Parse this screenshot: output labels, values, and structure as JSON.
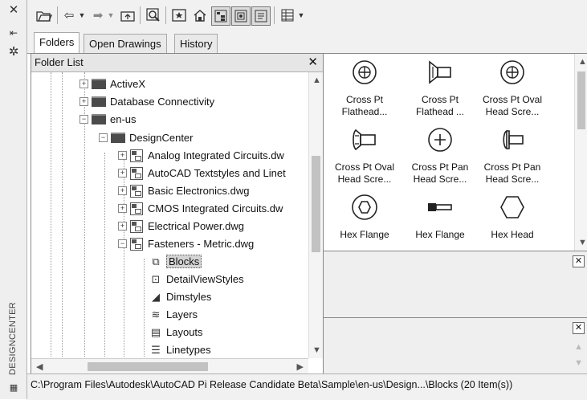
{
  "window": {
    "title": "DESIGNCENTER",
    "strip_icons": [
      "close-icon",
      "pin-icon",
      "properties-icon"
    ]
  },
  "toolbar": {
    "buttons": [
      "load-icon",
      "back-icon",
      "dropdown-icon",
      "forward-icon",
      "dropdown-icon",
      "up-icon",
      "search-icon",
      "favorites-icon",
      "home-icon",
      "tree-view-toggle-icon",
      "preview-toggle-icon",
      "description-toggle-icon",
      "views-icon",
      "dropdown-icon"
    ]
  },
  "tabs": [
    {
      "label": "Folders",
      "active": true
    },
    {
      "label": "Open Drawings",
      "active": false
    },
    {
      "label": "History",
      "active": false
    }
  ],
  "folder_list": {
    "header": "Folder List",
    "close": "✕",
    "items": [
      {
        "label": "ActiveX",
        "type": "folder",
        "expander": "+"
      },
      {
        "label": "Database Connectivity",
        "type": "folder",
        "expander": "+"
      },
      {
        "label": "en-us",
        "type": "folder",
        "expander": "−"
      },
      {
        "label": "DesignCenter",
        "type": "folder",
        "expander": "−"
      },
      {
        "label": "Analog Integrated Circuits.dw",
        "type": "dwg",
        "expander": "+"
      },
      {
        "label": "AutoCAD Textstyles and Linet",
        "type": "dwg",
        "expander": "+"
      },
      {
        "label": "Basic Electronics.dwg",
        "type": "dwg",
        "expander": "+"
      },
      {
        "label": "CMOS Integrated Circuits.dw",
        "type": "dwg",
        "expander": "+"
      },
      {
        "label": "Electrical Power.dwg",
        "type": "dwg",
        "expander": "+"
      },
      {
        "label": "Fasteners - Metric.dwg",
        "type": "dwg",
        "expander": "−"
      },
      {
        "label": "Blocks",
        "type": "leaf",
        "icon": "blocks-icon",
        "selected": true
      },
      {
        "label": "DetailViewStyles",
        "type": "leaf",
        "icon": "detail-view-styles-icon"
      },
      {
        "label": "Dimstyles",
        "type": "leaf",
        "icon": "dimstyles-icon"
      },
      {
        "label": "Layers",
        "type": "leaf",
        "icon": "layers-icon"
      },
      {
        "label": "Layouts",
        "type": "leaf",
        "icon": "layouts-icon"
      },
      {
        "label": "Linetypes",
        "type": "leaf",
        "icon": "linetypes-icon"
      }
    ]
  },
  "content": {
    "items": [
      {
        "label": "Cross Pt Flathead...",
        "icon": "cross-pt-flathead-top-icon"
      },
      {
        "label": "Cross Pt Flathead ...",
        "icon": "cross-pt-flathead-side-icon"
      },
      {
        "label": "Cross Pt Oval Head Scre...",
        "icon": "cross-pt-oval-head-top-icon"
      },
      {
        "label": "Cross Pt Oval Head Scre...",
        "icon": "cross-pt-oval-head-side-icon"
      },
      {
        "label": "Cross Pt Pan Head Scre...",
        "icon": "cross-pt-pan-head-top-icon"
      },
      {
        "label": "Cross Pt Pan Head Scre...",
        "icon": "cross-pt-pan-head-side-icon"
      },
      {
        "label": "Hex Flange",
        "icon": "hex-flange-top-icon"
      },
      {
        "label": "Hex Flange",
        "icon": "hex-flange-side-icon"
      },
      {
        "label": "Hex Head",
        "icon": "hex-head-top-icon"
      }
    ]
  },
  "preview_panel": {
    "close": "✕"
  },
  "description_panel": {
    "close": "✕"
  },
  "statusbar": {
    "path": "C:\\Program Files\\Autodesk\\AutoCAD Pi Release Candidate Beta\\Sample\\en-us\\Design...\\Blocks (20 Item(s))"
  }
}
